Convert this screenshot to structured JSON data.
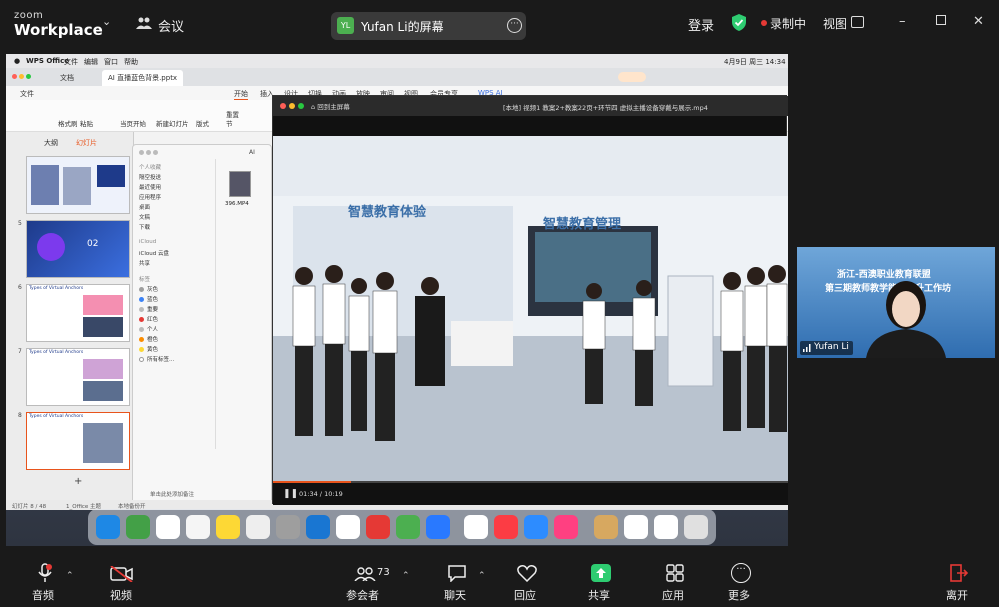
{
  "app": {
    "brand_small": "zoom",
    "brand_big": "Workplace",
    "meeting_label": "会议"
  },
  "share_pill": {
    "initials": "YL",
    "title": "Yufan Li的屏幕"
  },
  "header_right": {
    "login": "登录",
    "recording": "录制中",
    "view": "视图"
  },
  "shared_screen": {
    "menubar": {
      "app": "WPS Office",
      "items": [
        "文件",
        "编辑",
        "窗口",
        "帮助"
      ],
      "clock": "4月9日 周三 14:34"
    },
    "wps": {
      "tabs": [
        "文档",
        "AI 直播蓝色背景.pptx"
      ],
      "ribbon_tabs": [
        "文件",
        "开始",
        "插入",
        "设计",
        "切换",
        "动画",
        "放映",
        "审阅",
        "视图",
        "会员专享",
        "WPS AI"
      ],
      "ribbon_buttons": [
        "格式刷",
        "粘贴",
        "当页开始",
        "新建幻灯片",
        "版式",
        "重置",
        "节"
      ],
      "pane_tabs": [
        "大纲",
        "幻灯片"
      ],
      "slide_numbers": [
        "5",
        "6",
        "7",
        "8"
      ],
      "slide_titles": [
        "Types of Virtual Anchors",
        "Types of Virtual Anchors",
        "Types of Virtual Anchors"
      ],
      "slide5_title": "02",
      "status": {
        "slide": "幻灯片 8 / 48",
        "theme": "1_Office 主题",
        "backup": "本地备份开",
        "notes": "单击此处添加备注"
      }
    },
    "finder": {
      "path": "AI",
      "sections": [
        "个人收藏",
        "iCloud",
        "标签"
      ],
      "favorites": [
        "隔空投送",
        "最近使用",
        "应用程序",
        "桌面",
        "文稿",
        "下载"
      ],
      "icloud": [
        "iCloud 云盘",
        "共享"
      ],
      "tags": [
        {
          "name": "灰色",
          "color": "#9e9e9e"
        },
        {
          "name": "蓝色",
          "color": "#3b82f6"
        },
        {
          "name": "重要",
          "color": "#bbbbbb"
        },
        {
          "name": "红色",
          "color": "#e53935"
        },
        {
          "name": "个人",
          "color": "#bbbbbb"
        },
        {
          "name": "橙色",
          "color": "#fb8c00"
        },
        {
          "name": "黄色",
          "color": "#fdd835"
        },
        {
          "name": "所有标签...",
          "color": "#ffffff"
        }
      ],
      "file": "396.MP4"
    },
    "player": {
      "home_btn": "回到主屏幕",
      "title": "[本地] 视频1 教案2+教案22页+环节四 虚拟主播设备穿戴与展示.mp4",
      "time_current": "01:34",
      "time_total": "10:19",
      "progress": 0.152,
      "scene_banner_left": "智慧教育体验",
      "scene_banner_right": "智慧教育管理"
    }
  },
  "self_video": {
    "name": "Yufan Li",
    "banner_line1": "浙江-西澳职业教育联盟",
    "banner_line2": "第三期教师教学能力提升工作坊"
  },
  "toolbar": {
    "audio": "音频",
    "video": "视频",
    "participants": "参会者",
    "participants_count": "73",
    "chat": "聊天",
    "react": "回应",
    "share": "共享",
    "apps": "应用",
    "more": "更多",
    "leave": "离开"
  }
}
